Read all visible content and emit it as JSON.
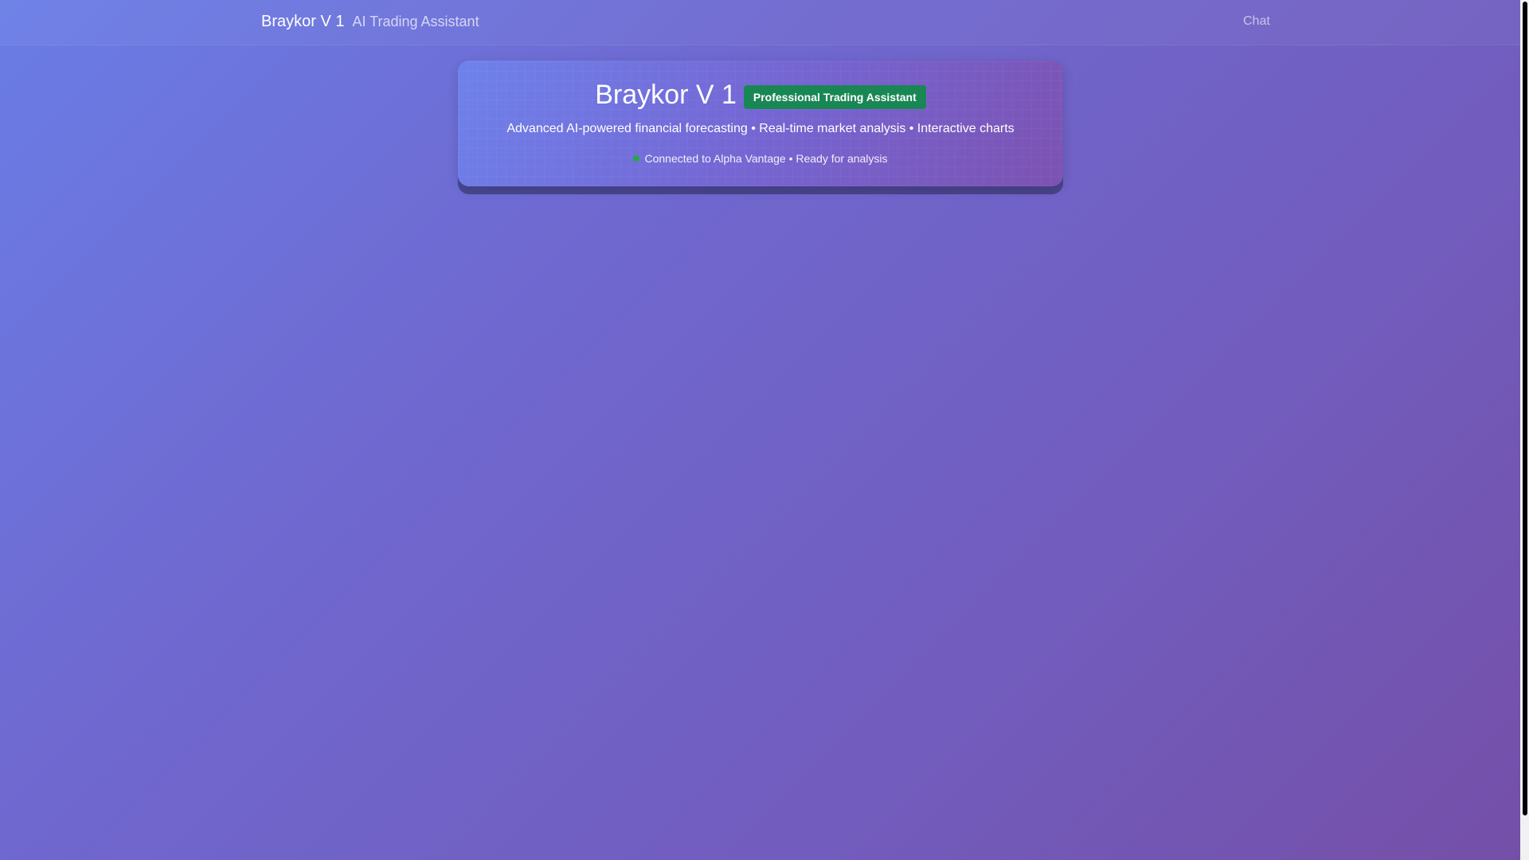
{
  "navbar": {
    "brand": "Braykor V 1",
    "brand_subtitle": "AI Trading Assistant",
    "chat_link": "Chat"
  },
  "hero": {
    "title": "Braykor V 1",
    "badge": "Professional Trading Assistant",
    "description": "Advanced AI-powered financial forecasting • Real-time market analysis • Interactive charts",
    "status_text": "Connected to Alpha Vantage • Ready for analysis",
    "status_color": "#28a745"
  },
  "colors": {
    "background_start": "#6a7de6",
    "background_end": "#744fa8",
    "badge": "#198754"
  }
}
